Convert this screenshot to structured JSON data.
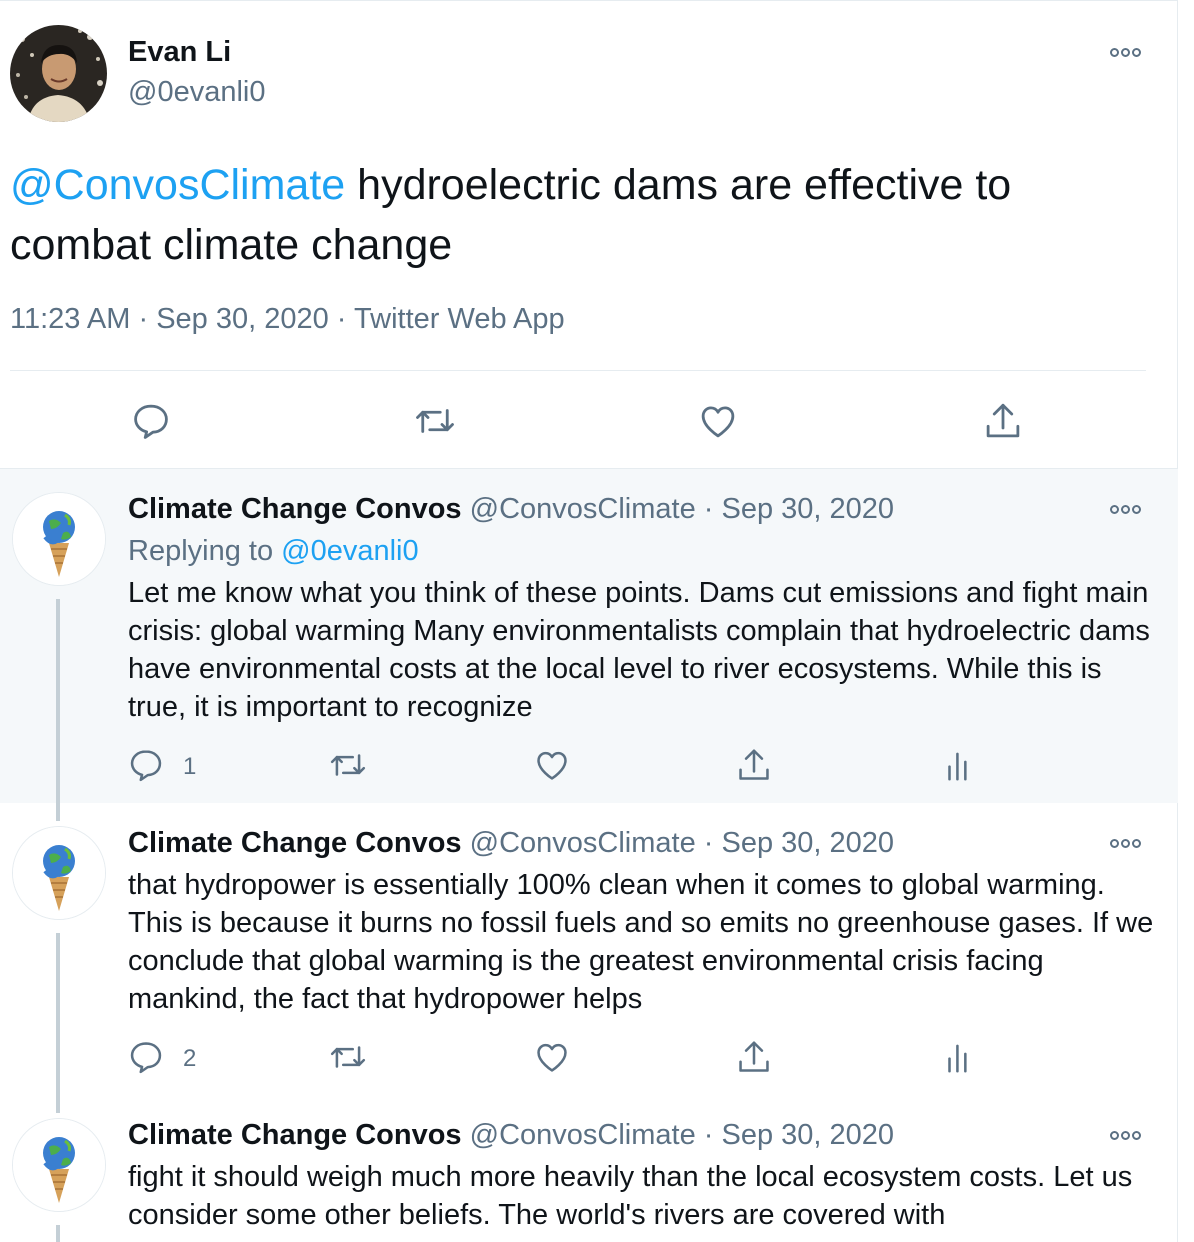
{
  "main_tweet": {
    "name": "Evan Li",
    "handle": "@0evanli0",
    "mention": "@ConvosClimate",
    "text": " hydroelectric dams are effective to combat climate change",
    "time": "11:23 AM",
    "separator": "·",
    "date": "Sep 30, 2020",
    "source": "Twitter Web App",
    "actions": [
      "reply-icon",
      "retweet-icon",
      "like-icon",
      "share-icon"
    ]
  },
  "replies": [
    {
      "name": "Climate Change Convos",
      "handle": "@ConvosClimate",
      "separator": "·",
      "date": "Sep 30, 2020",
      "replying_prefix": "Replying to ",
      "replying_to": "@0evanli0",
      "text": "Let me know what you think of these points. Dams cut emissions and fight main crisis: global warming Many environmentalists complain that hydroelectric dams have environmental costs at the local level to river ecosystems. While this is true, it is important to recognize",
      "reply_count": "1"
    },
    {
      "name": "Climate Change Convos",
      "handle": "@ConvosClimate",
      "separator": "·",
      "date": "Sep 30, 2020",
      "text": "that hydropower is essentially 100% clean when it comes to global warming. This is because it burns no fossil fuels and so emits no greenhouse gases. If we conclude that global warming is the greatest environmental crisis facing mankind, the fact that hydropower helps",
      "reply_count": "2"
    },
    {
      "name": "Climate Change Convos",
      "handle": "@ConvosClimate",
      "separator": "·",
      "date": "Sep 30, 2020",
      "text": "fight it should weigh much more heavily than the local ecosystem costs. Let us consider some other beliefs. The world's rivers are covered with"
    }
  ],
  "colors": {
    "accent": "#1da1f2",
    "text": "#0f1419",
    "secondary": "#5b7083",
    "highlight_bg": "#f5f8fa",
    "border": "#e6ecf0"
  }
}
